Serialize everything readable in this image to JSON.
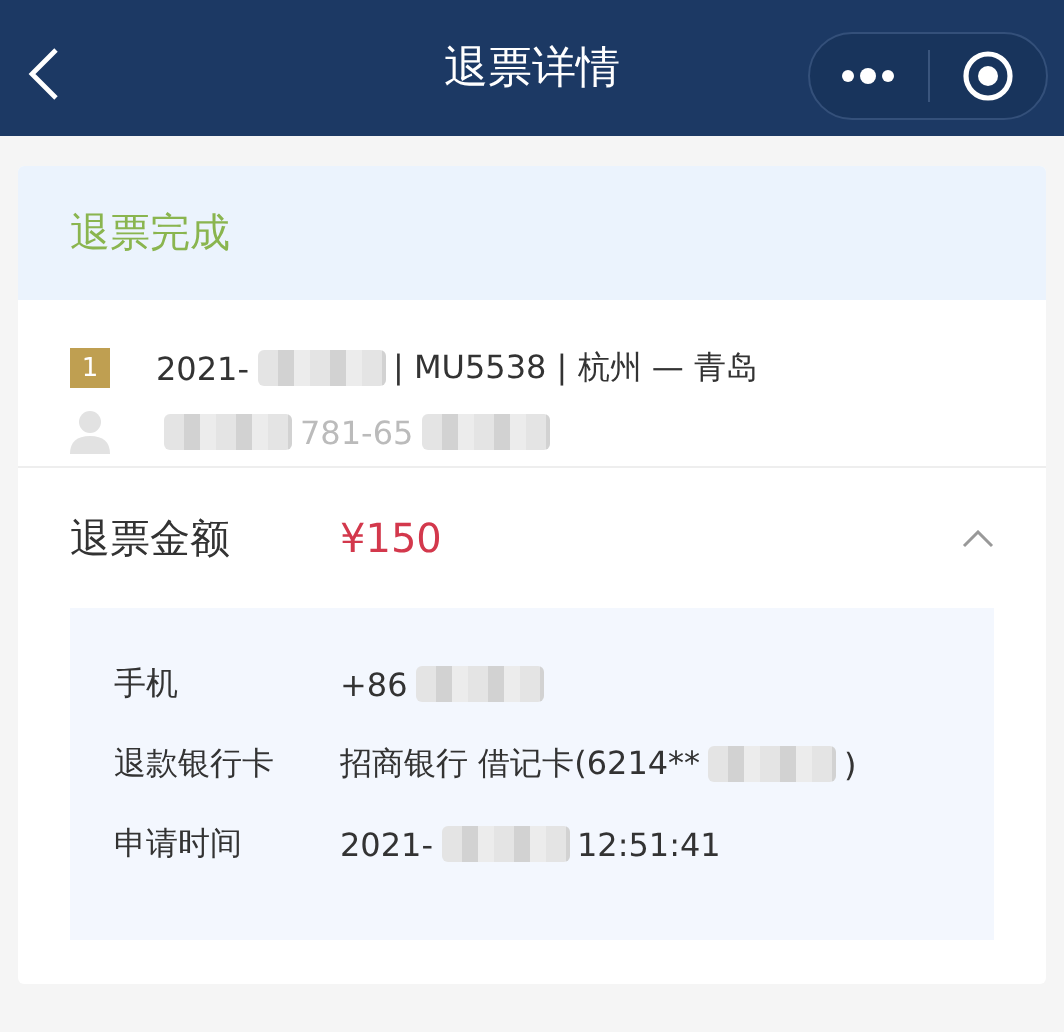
{
  "nav_bar": {
    "title": "退票详情"
  },
  "status": {
    "text": "退票完成"
  },
  "trip": {
    "badge": "1",
    "flight_line": [
      {
        "kind": "text",
        "text": "2021-"
      },
      {
        "kind": "blur"
      },
      {
        "kind": "text",
        "text": "| MU5538 | 杭州 — 青岛"
      }
    ],
    "passenger_line": [
      {
        "kind": "blur"
      },
      {
        "kind": "text",
        "text": "781-65"
      },
      {
        "kind": "blur"
      }
    ]
  },
  "refund": {
    "label": "退票金额",
    "amount": "¥150",
    "expanded": true,
    "details": [
      {
        "label": "手机",
        "value": [
          {
            "kind": "text",
            "text": "+86"
          },
          {
            "kind": "blur"
          }
        ]
      },
      {
        "label": "退款银行卡",
        "value": [
          {
            "kind": "text",
            "text": "招商银行 借记卡(6214**"
          },
          {
            "kind": "blur"
          },
          {
            "kind": "text",
            "text": ")"
          }
        ]
      },
      {
        "label": "申请时间",
        "value": [
          {
            "kind": "text",
            "text": "2021-"
          },
          {
            "kind": "blur"
          },
          {
            "kind": "text",
            "text": "12:51:41"
          }
        ]
      }
    ]
  }
}
